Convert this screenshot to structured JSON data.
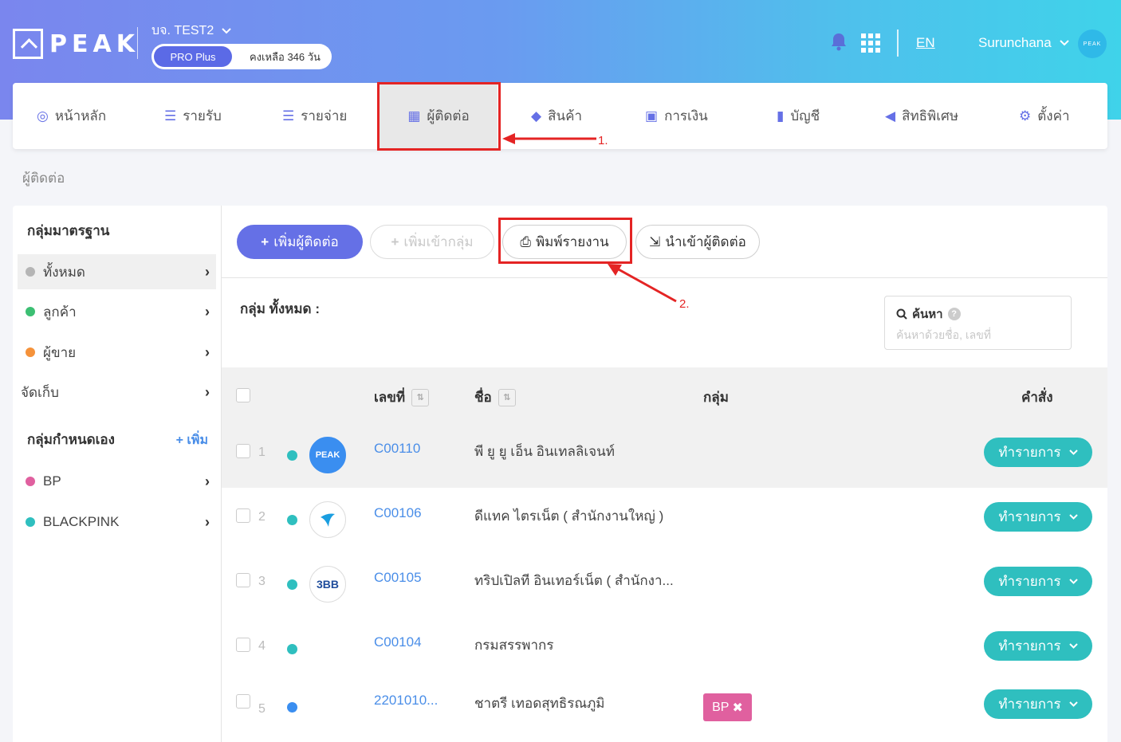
{
  "header": {
    "logo": "PEAK",
    "company": "บจ. TEST2",
    "plan": "PRO Plus",
    "remaining": "คงเหลือ 346 วัน",
    "lang": "EN",
    "user": "Surunchana",
    "avatar_text": "PEAK"
  },
  "nav": [
    {
      "label": "หน้าหลัก",
      "icon": "dashboard-icon"
    },
    {
      "label": "รายรับ",
      "icon": "income-icon"
    },
    {
      "label": "รายจ่าย",
      "icon": "expense-icon"
    },
    {
      "label": "ผู้ติดต่อ",
      "icon": "contacts-icon"
    },
    {
      "label": "สินค้า",
      "icon": "box-icon"
    },
    {
      "label": "การเงิน",
      "icon": "money-icon"
    },
    {
      "label": "บัญชี",
      "icon": "book-icon"
    },
    {
      "label": "สิทธิพิเศษ",
      "icon": "megaphone-icon"
    },
    {
      "label": "ตั้งค่า",
      "icon": "gear-icon"
    }
  ],
  "annotations": {
    "one": "1.",
    "two": "2."
  },
  "breadcrumb": "ผู้ติดต่อ",
  "sidebar": {
    "standard_title": "กลุ่มมาตรฐาน",
    "standard": [
      {
        "label": "ทั้งหมด",
        "color": "#b5b5b5"
      },
      {
        "label": "ลูกค้า",
        "color": "#3cbf73"
      },
      {
        "label": "ผู้ขาย",
        "color": "#f5923a"
      },
      {
        "label": "จัดเก็บ",
        "color": ""
      }
    ],
    "custom_title": "กลุ่มกำหนดเอง",
    "add_label": "+ เพิ่ม",
    "custom": [
      {
        "label": "BP",
        "color": "#e0609f"
      },
      {
        "label": "BLACKPINK",
        "color": "#2fbfbf"
      }
    ]
  },
  "toolbar": {
    "add_contact": "เพิ่มผู้ติดต่อ",
    "add_to_group": "เพิ่มเข้ากลุ่ม",
    "print_report": "พิมพ์รายงาน",
    "import_contacts": "นำเข้าผู้ติดต่อ"
  },
  "group_label": "กลุ่ม ทั้งหมด :",
  "search": {
    "title": "ค้นหา",
    "placeholder": "ค้นหาด้วยชื่อ, เลขที่"
  },
  "table": {
    "headers": {
      "number": "เลขที่",
      "name": "ชื่อ",
      "group": "กลุ่ม",
      "command": "คำสั่ง"
    },
    "action_label": "ทำรายการ",
    "rows": [
      {
        "num": "1",
        "code": "C00110",
        "name": "พี ยู ยู เอ็น อินเทลลิเจนท์",
        "dot": "#2fbfbf",
        "avatar": "PEAK",
        "tag": ""
      },
      {
        "num": "2",
        "code": "C00106",
        "name": "ดีแทค ไตรเน็ต ( สำนักงานใหญ่ )",
        "dot": "#2fbfbf",
        "avatar": "dtac",
        "tag": ""
      },
      {
        "num": "3",
        "code": "C00105",
        "name": "ทริปเปิลที อินเทอร์เน็ต ( สำนักงา...",
        "dot": "#2fbfbf",
        "avatar": "3BB",
        "tag": ""
      },
      {
        "num": "4",
        "code": "C00104",
        "name": "กรมสรรพากร",
        "dot": "#2fbfbf",
        "avatar": "",
        "tag": ""
      },
      {
        "num": "5",
        "code": "2201010...",
        "name": "ชาตรี เทอดสุทธิรณภูมิ",
        "dot": "#3a8ef0",
        "avatar": "",
        "tag": "BP"
      }
    ]
  }
}
